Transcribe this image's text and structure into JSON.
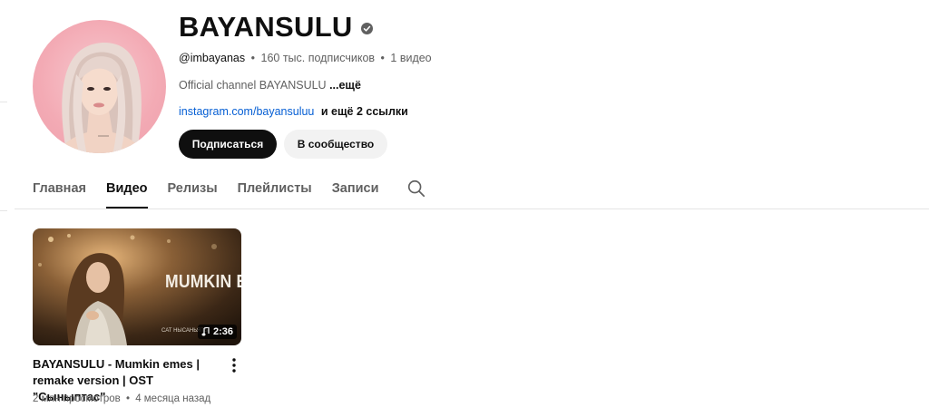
{
  "channel": {
    "name": "BAYANSULU",
    "handle": "@imbayanas",
    "separator": "•",
    "subscribers": "160 тыс. подписчиков",
    "video_count": "1 видео",
    "description": "Official channel BAYANSULU",
    "description_more": "...ещё",
    "link": "instagram.com/bayansuluu",
    "more_links": "и ещё 2 ссылки"
  },
  "buttons": {
    "subscribe": "Подписаться",
    "community": "В сообщество"
  },
  "tabs": [
    {
      "label": "Главная",
      "active": false
    },
    {
      "label": "Видео",
      "active": true
    },
    {
      "label": "Релизы",
      "active": false
    },
    {
      "label": "Плейлисты",
      "active": false
    },
    {
      "label": "Записи",
      "active": false
    }
  ],
  "video": {
    "thumbnail_text": "MUMKIN EMES",
    "thumbnail_caption": "САТ НЫСАНЬЯТЫ",
    "duration": "2:36",
    "title": "BAYANSULU - Mumkin emes | remake version | OST \"Сыныптас\"",
    "views": "2 млн просмотров",
    "separator": "•",
    "age": "4 месяца назад"
  },
  "colors": {
    "primary_text": "#0f0f0f",
    "secondary_text": "#606060",
    "link": "#065fd4",
    "subscribe_bg": "#0f0f0f",
    "community_bg": "#f2f2f2"
  },
  "icons": {
    "verified": "verified-icon",
    "search": "search-icon",
    "more": "more-vert-icon",
    "music_note": "music-note-icon"
  }
}
